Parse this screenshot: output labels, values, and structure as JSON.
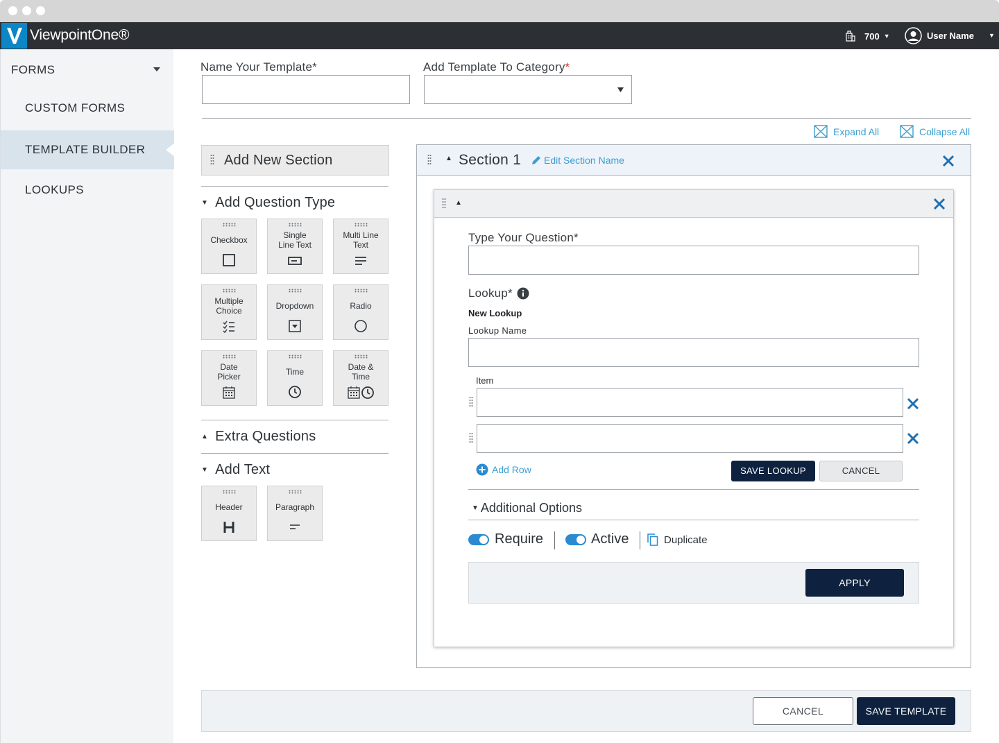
{
  "app": {
    "title": "ViewpointOne®",
    "company_code": "700",
    "user_name": "User Name"
  },
  "sidebar": {
    "heading": "FORMS",
    "items": [
      {
        "label": "CUSTOM FORMS",
        "active": false
      },
      {
        "label": "TEMPLATE BUILDER",
        "active": true
      },
      {
        "label": "LOOKUPS",
        "active": false
      }
    ]
  },
  "template": {
    "name_label": "Name Your Template*",
    "name_value": "",
    "category_label": "Add Template To Category",
    "category_required_mark": "*",
    "category_value": ""
  },
  "toolbar": {
    "expand_all": "Expand All",
    "collapse_all": "Collapse All"
  },
  "palette": {
    "add_section": "Add New Section",
    "question_type_title": "Add Question Type",
    "question_types": [
      {
        "label": "Checkbox",
        "icon": "checkbox-icon"
      },
      {
        "label": "Single Line Text",
        "icon": "single-line-text-icon"
      },
      {
        "label": "Multi Line Text",
        "icon": "multi-line-text-icon"
      },
      {
        "label": "Multiple Choice",
        "icon": "multiple-choice-icon"
      },
      {
        "label": "Dropdown",
        "icon": "dropdown-icon"
      },
      {
        "label": "Radio",
        "icon": "radio-icon"
      },
      {
        "label": "Date Picker",
        "icon": "calendar-icon"
      },
      {
        "label": "Time",
        "icon": "clock-icon"
      },
      {
        "label": "Date & Time",
        "icon": "calendar-clock-icon"
      }
    ],
    "extra_questions_title": "Extra Questions",
    "add_text_title": "Add Text",
    "text_types": [
      {
        "label": "Header",
        "icon": "header-icon"
      },
      {
        "label": "Paragraph",
        "icon": "paragraph-icon"
      }
    ]
  },
  "section": {
    "title": "Section 1",
    "edit_label": "Edit Section Name",
    "question": {
      "question_label": "Type Your Question*",
      "question_value": "",
      "lookup_label": "Lookup*",
      "new_lookup_heading": "New Lookup",
      "lookup_name_label": "Lookup Name",
      "lookup_name_value": "",
      "item_label": "Item",
      "items": [
        "",
        ""
      ],
      "add_row": "Add Row",
      "save_lookup": "SAVE LOOKUP",
      "cancel_lookup": "CANCEL",
      "additional_options": "Additional Options",
      "require_label": "Require",
      "require_on": true,
      "active_label": "Active",
      "active_on": true,
      "duplicate_label": "Duplicate",
      "apply": "APPLY"
    }
  },
  "footer": {
    "cancel": "CANCEL",
    "save": "SAVE TEMPLATE"
  },
  "colors": {
    "accent": "#3b9ed1",
    "brand": "#0d86c6",
    "dark_button": "#0e2240",
    "topbar": "#2c3034",
    "required": "#d0312d"
  }
}
